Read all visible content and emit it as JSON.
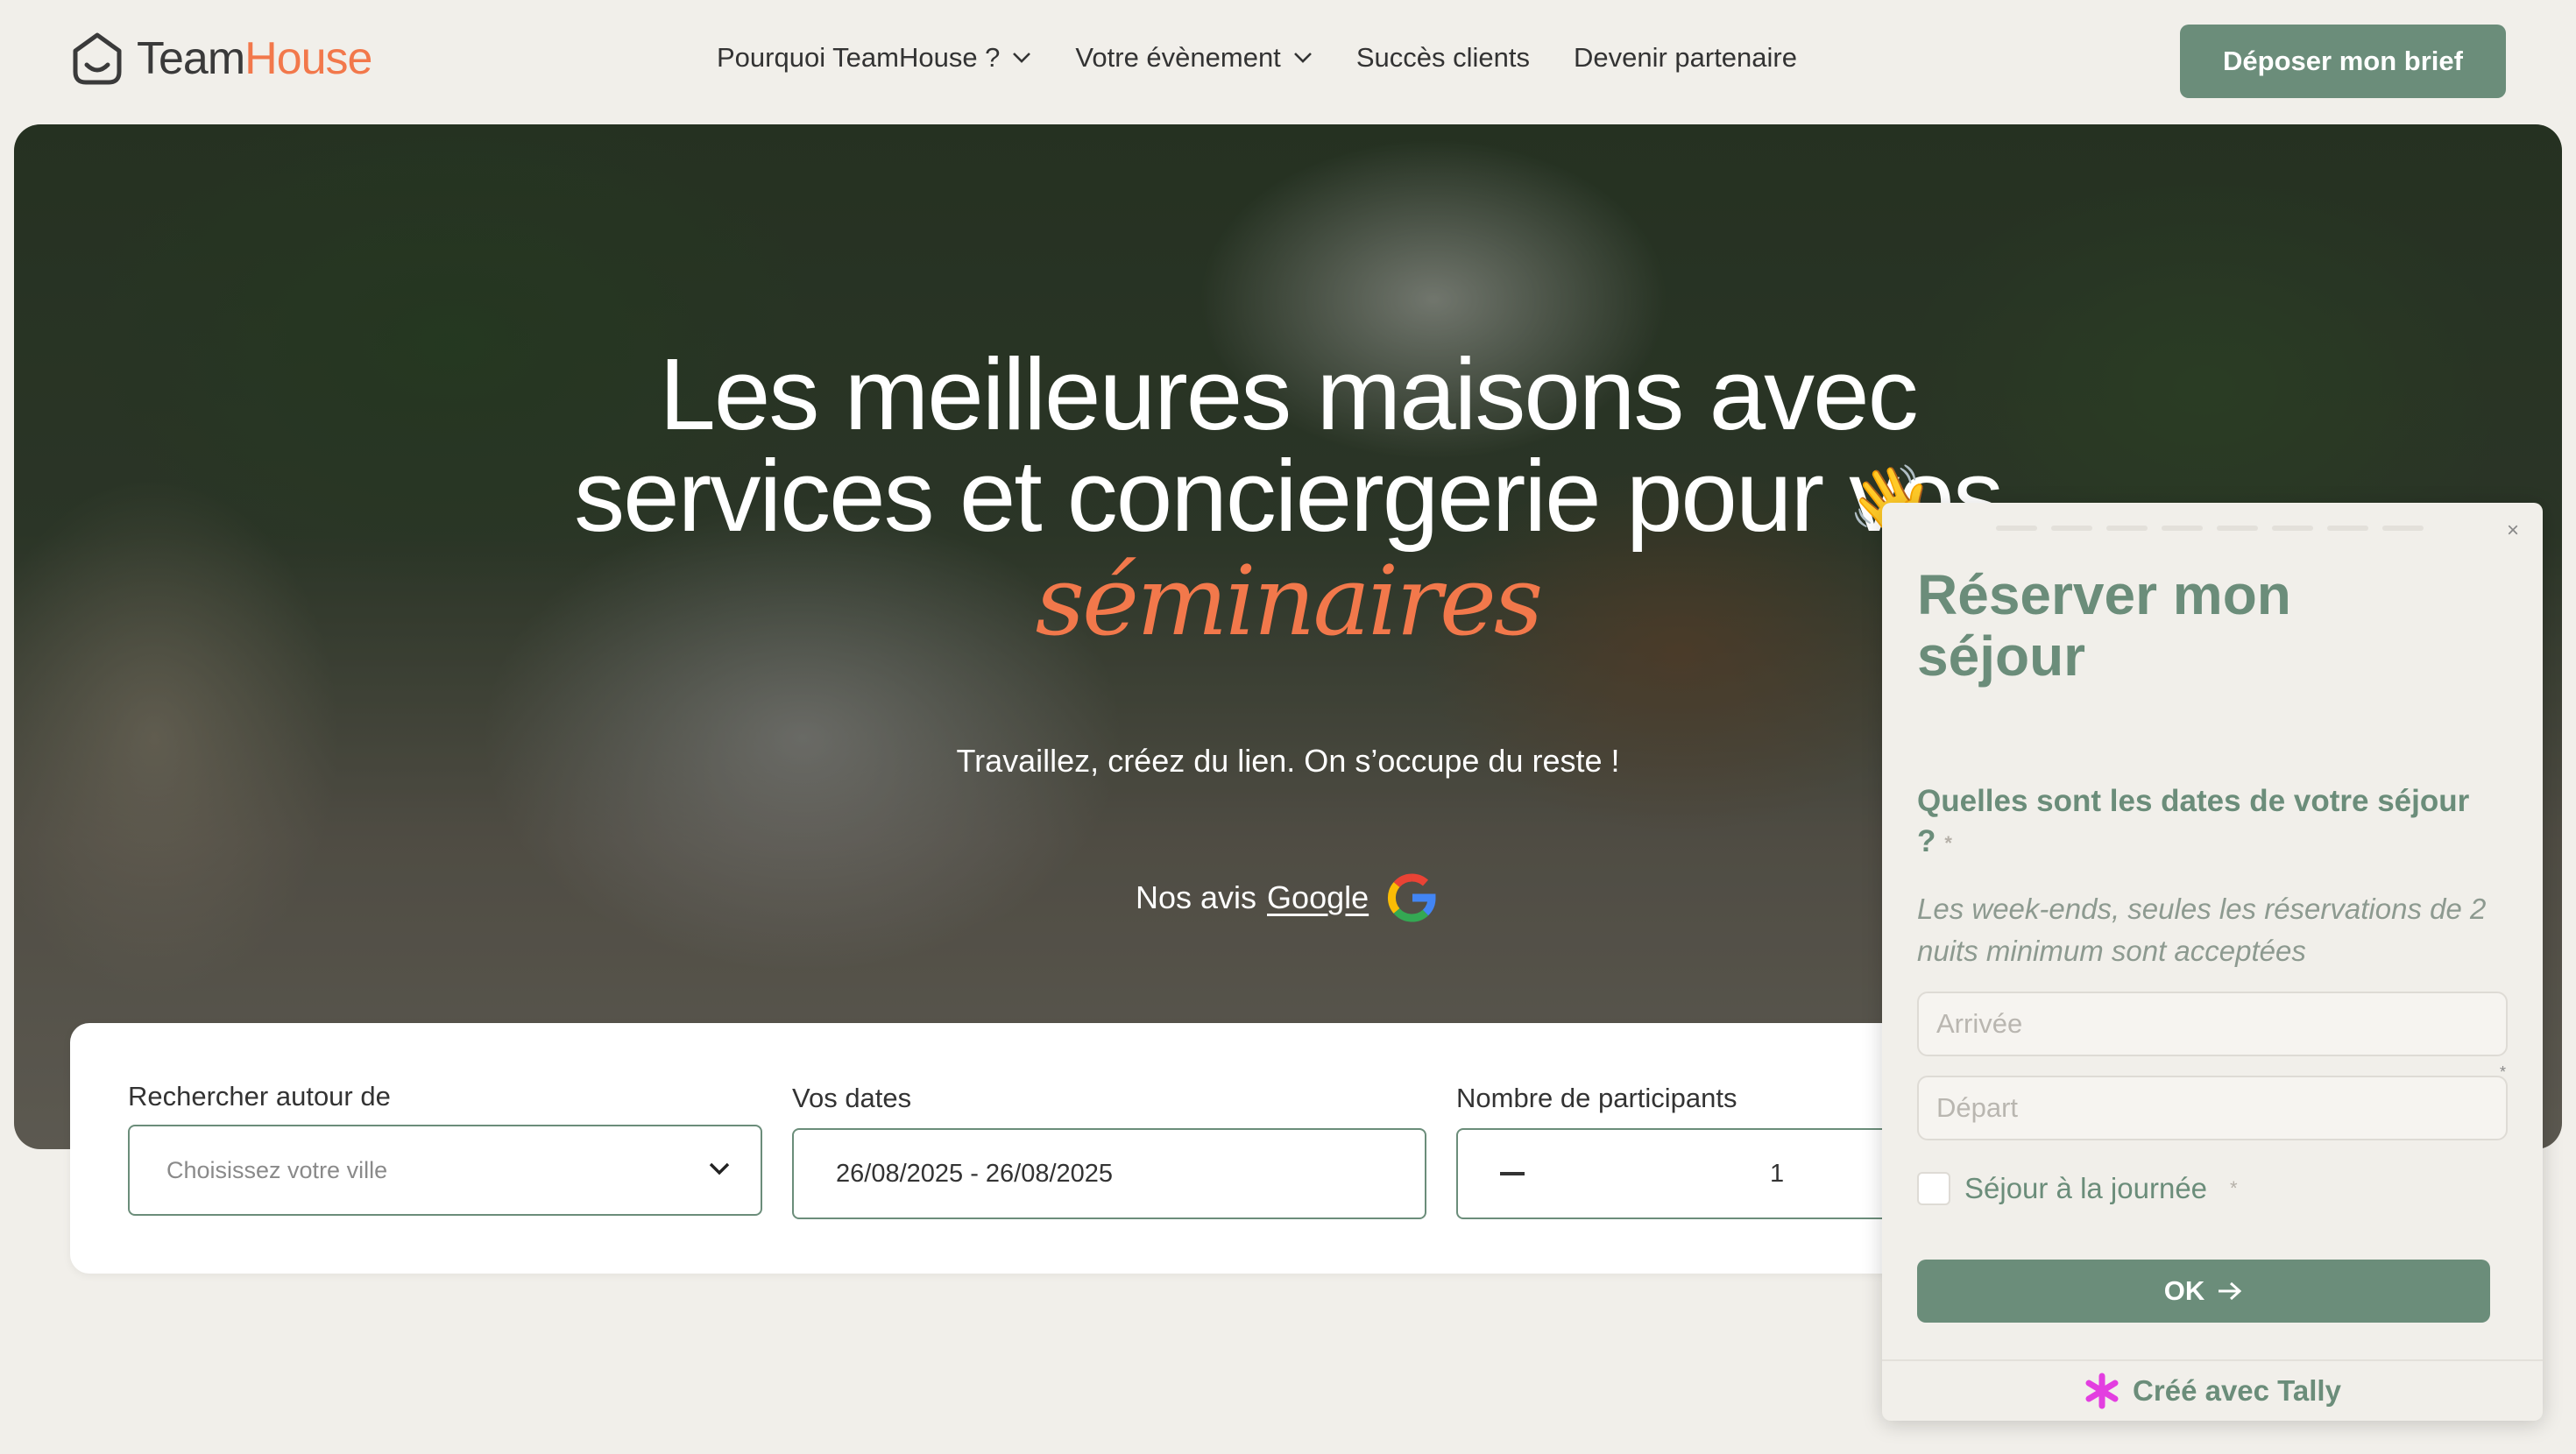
{
  "nav": {
    "logo_part1": "Team",
    "logo_part2": "House",
    "links": [
      {
        "label": "Pourquoi TeamHouse ?",
        "has_dropdown": true
      },
      {
        "label": "Votre évènement",
        "has_dropdown": true
      },
      {
        "label": "Succès clients",
        "has_dropdown": false
      },
      {
        "label": "Devenir partenaire",
        "has_dropdown": false
      }
    ],
    "cta_label": "Déposer mon brief"
  },
  "hero": {
    "title_line1": "Les meilleures maisons avec",
    "title_line2": "services et conciergerie pour vos",
    "title_accent": "séminaires",
    "subtitle": "Travaillez, créez du lien. On s’occupe du reste !",
    "reviews_prefix": "Nos avis",
    "reviews_link": "Google",
    "wave_emoji": "👋"
  },
  "search": {
    "location_label": "Rechercher autour de",
    "location_placeholder": "Choisissez votre ville",
    "dates_label": "Vos dates",
    "dates_value": "26/08/2025 - 26/08/2025",
    "participants_label": "Nombre de participants",
    "participants_value": "1"
  },
  "popup": {
    "title": "Réserver mon séjour",
    "question": "Quelles sont les dates de votre séjour ?",
    "required_mark": "*",
    "help": "Les week-ends, seules les réservations de 2 nuits minimum sont acceptées",
    "arrival_placeholder": "Arrivée",
    "departure_placeholder": "Départ",
    "day_stay_label": "Séjour à la journée",
    "ok_label": "OK",
    "footer": "Créé avec Tally",
    "close_glyph": "×"
  },
  "colors": {
    "accent_green": "#6b8d7a",
    "accent_orange": "#f2784b",
    "background": "#f1efea",
    "tally_pink": "#e33ee0"
  }
}
